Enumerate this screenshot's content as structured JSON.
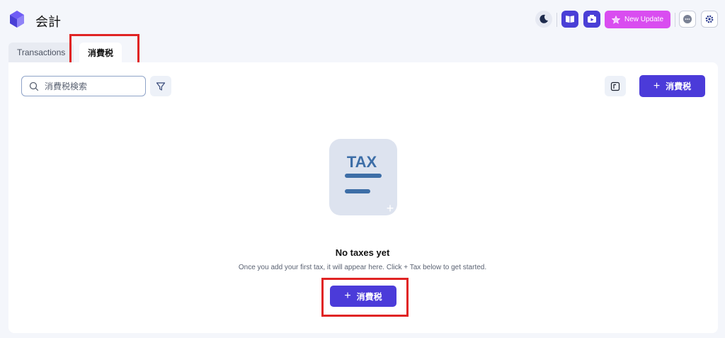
{
  "header": {
    "app_title": "会計",
    "new_update_label": "New Update"
  },
  "tabs": [
    {
      "label": "Transactions",
      "active": false
    },
    {
      "label": "消費税",
      "active": true
    }
  ],
  "toolbar": {
    "search_placeholder": "消費税検索",
    "add_label": "消費税"
  },
  "empty_state": {
    "illustration_text": "TAX",
    "title": "No taxes yet",
    "description": "Once you add your first tax, it will appear here. Click + Tax below to get started.",
    "add_label": "消費税"
  },
  "icons": {
    "logo": "cube-logo-icon",
    "theme": "moon-icon",
    "docs": "book-icon",
    "video": "video-icon",
    "update": "star-icon",
    "chat": "chat-icon",
    "settings": "gear-icon",
    "search": "search-icon",
    "filter": "filter-icon",
    "columns": "columns-icon",
    "add": "plus-icon"
  },
  "colors": {
    "accent": "#4b3bd9",
    "update": "#d94df0",
    "highlight": "#e02424",
    "background": "#f4f6fb"
  }
}
